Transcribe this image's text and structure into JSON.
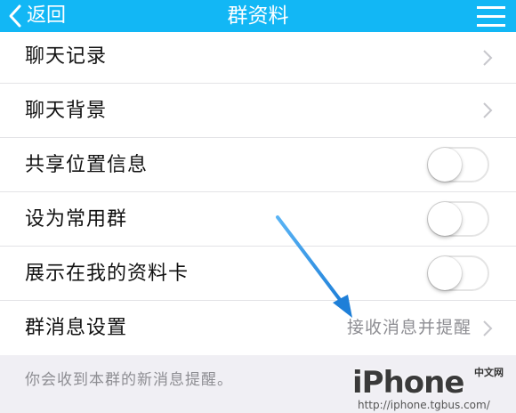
{
  "navbar": {
    "back_label": "返回",
    "title": "群资料",
    "menu_icon": "hamburger-menu-icon",
    "color": "#12b7f5"
  },
  "rows": [
    {
      "label": "聊天记录",
      "control": "chevron"
    },
    {
      "label": "聊天背景",
      "control": "chevron"
    },
    {
      "label": "共享位置信息",
      "control": "toggle",
      "on": false
    },
    {
      "label": "设为常用群",
      "control": "toggle",
      "on": false
    },
    {
      "label": "展示在我的资料卡",
      "control": "toggle",
      "on": false
    },
    {
      "label": "群消息设置",
      "control": "chevron",
      "value": "接收消息并提醒"
    }
  ],
  "footer_note": "你会收到本群的新消息提醒。",
  "annotation": {
    "type": "arrow",
    "color": "#2f8fe8"
  },
  "watermark": {
    "logo": "iPhone",
    "badge": "中文网",
    "url": "http://iphone.tgbus.com/"
  }
}
